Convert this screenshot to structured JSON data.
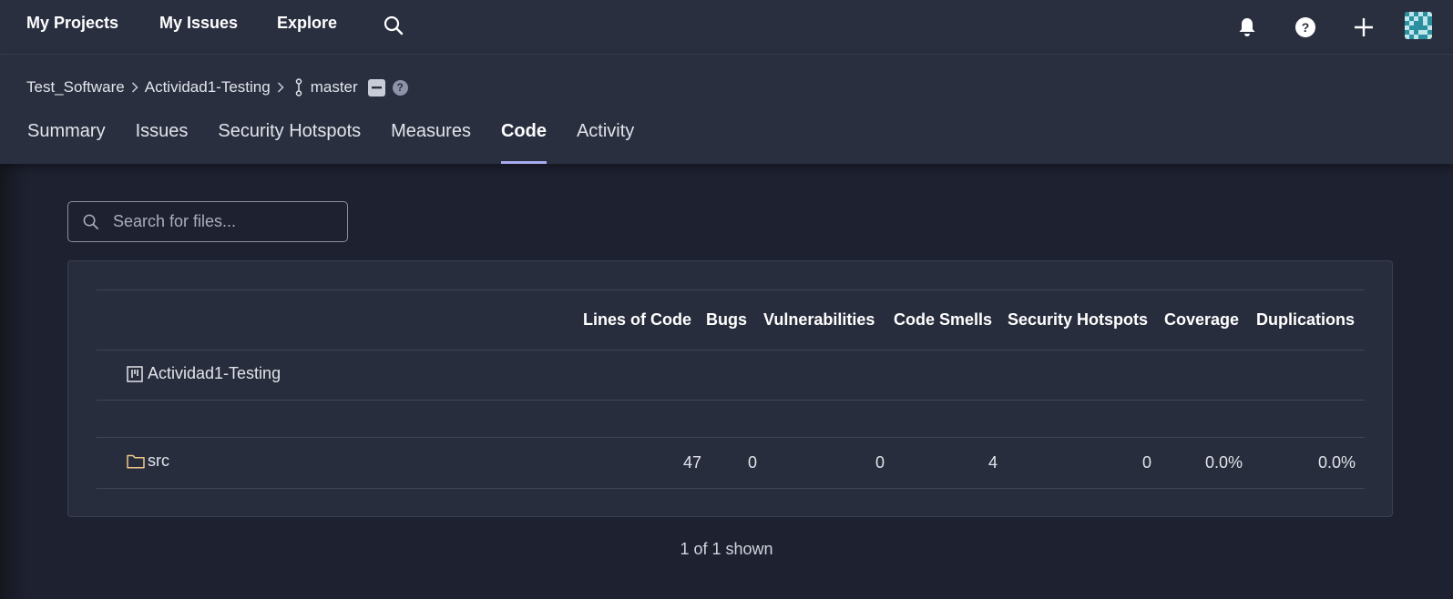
{
  "topnav": {
    "links": [
      "My Projects",
      "My Issues",
      "Explore"
    ],
    "search_icon": "search-icon",
    "notifications_icon": "bell-icon",
    "help_icon": "help-circle-icon",
    "create_icon": "plus-icon",
    "avatar_icon": "user-avatar"
  },
  "breadcrumb": {
    "organization": "Test_Software",
    "project": "Actividad1-Testing",
    "branch_icon": "branch-icon",
    "branch": "master"
  },
  "tabs": [
    "Summary",
    "Issues",
    "Security Hotspots",
    "Measures",
    "Code",
    "Activity"
  ],
  "active_tab": "Code",
  "search": {
    "placeholder": "Search for files..."
  },
  "table": {
    "columns": [
      "Lines of Code",
      "Bugs",
      "Vulnerabilities",
      "Code Smells",
      "Security Hotspots",
      "Coverage",
      "Duplications"
    ],
    "project_row": {
      "icon": "project-icon",
      "name": "Actividad1-Testing"
    },
    "rows": [
      {
        "icon": "folder-icon",
        "name": "src",
        "values": [
          "47",
          "0",
          "0",
          "4",
          "0",
          "0.0%",
          "0.0%"
        ]
      }
    ]
  },
  "footer": {
    "count": "1 of 1 shown"
  },
  "colors": {
    "accent": "#a7acee",
    "background": "#1e2130",
    "header": "#2a2f40",
    "folder": "#f0c88a"
  }
}
